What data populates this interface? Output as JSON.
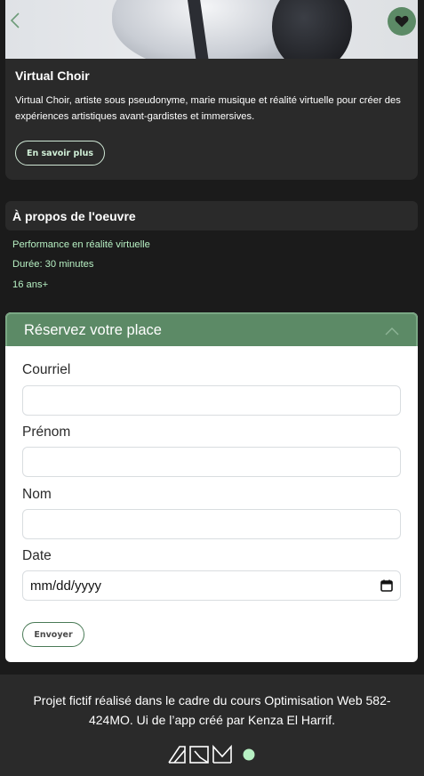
{
  "artist": {
    "title": "Virtual Choir",
    "description": "Virtual Choir, artiste sous pseudonyme, marie musique et réalité virtuelle pour créer des expériences artistiques avant-gardistes et immersives.",
    "more_label": "En savoir plus",
    "back_icon": "chevron-left-icon",
    "favorite_icon": "heart-icon"
  },
  "about": {
    "heading": "À propos de l'oeuvre",
    "lines": [
      "Performance en réalité virtuelle",
      "Durée: 30 minutes",
      "16 ans+"
    ]
  },
  "booking": {
    "heading": "Réservez votre place",
    "toggle_icon": "chevron-up-icon",
    "fields": [
      {
        "label": "Courriel",
        "value": ""
      },
      {
        "label": "Prénom",
        "value": ""
      },
      {
        "label": "Nom",
        "value": ""
      },
      {
        "label": "Date",
        "value": "mm/dd/yyyy",
        "icon": "calendar-icon"
      }
    ],
    "submit_label": "Envoyer"
  },
  "footer": {
    "credit": "Projet fictif réalisé dans le cadre du cours Optimisation Web 582-424MO. Ui de l’app créé par Kenza El Harrif.",
    "logo_icon": "aqm-logo"
  },
  "colors": {
    "accent": "#5c8a66",
    "accent_text": "#b7f0c3",
    "background": "#1b1b1b",
    "card": "#2a2a2a"
  }
}
